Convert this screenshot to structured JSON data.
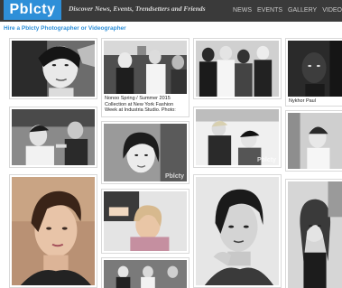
{
  "header": {
    "logo": "Pblcty",
    "tagline": "Discover News, Events, Trendsetters and Friends",
    "nav": [
      "NEWS",
      "EVENTS",
      "GALLERY",
      "VIDEO"
    ]
  },
  "hire_link": "Hire a Pblcty Photographer or Videographer",
  "watermark": "Pblcty",
  "captions": {
    "nonoo": "Nonoo Spring / Summer 2015 Collection at New York Fashion Week at Industria Studio. Photo:",
    "nykhor": "Nykhor Paul"
  },
  "colors": {
    "brand_blue": "#2e8fd8",
    "topbar": "#3a3a3a"
  }
}
